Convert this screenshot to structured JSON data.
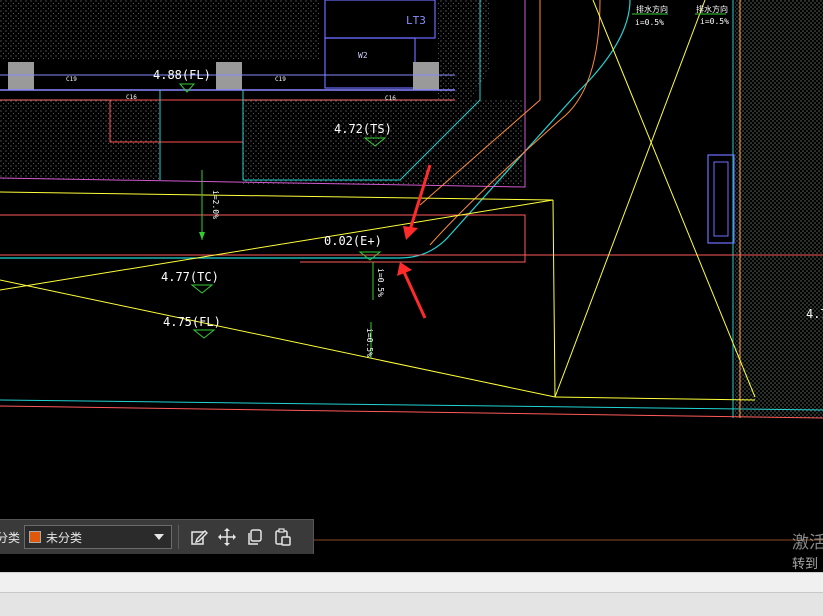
{
  "labels": {
    "lt3": "LT3",
    "w2": "W2",
    "c19a": "C19",
    "c19b": "C19",
    "c16a": "C16",
    "c16b": "C16",
    "elev_fl_top": "4.88(FL)",
    "elev_ts": "4.72(TS)",
    "elev_e": "0.02(E+)",
    "elev_tc": "4.77(TC)",
    "elev_fl": "4.75(FL)",
    "elev_right": "4.7",
    "slope_top_1": "i=0.5%",
    "slope_top_2": "i=0.5%",
    "slope_mid_1": "i=2.0%",
    "slope_mid_2": "i=0.5%",
    "slope_mid_3": "i=0.5%",
    "flow_dir_1": "排水方向",
    "flow_dir_2": "排水方向"
  },
  "toolbar": {
    "category_label": "分类",
    "category_value": "未分类",
    "category_color": "#e0580b"
  },
  "watermark": {
    "line1": "激活",
    "line2": "转到"
  },
  "colors": {
    "annotation_arrow": "#ff2a2a"
  }
}
